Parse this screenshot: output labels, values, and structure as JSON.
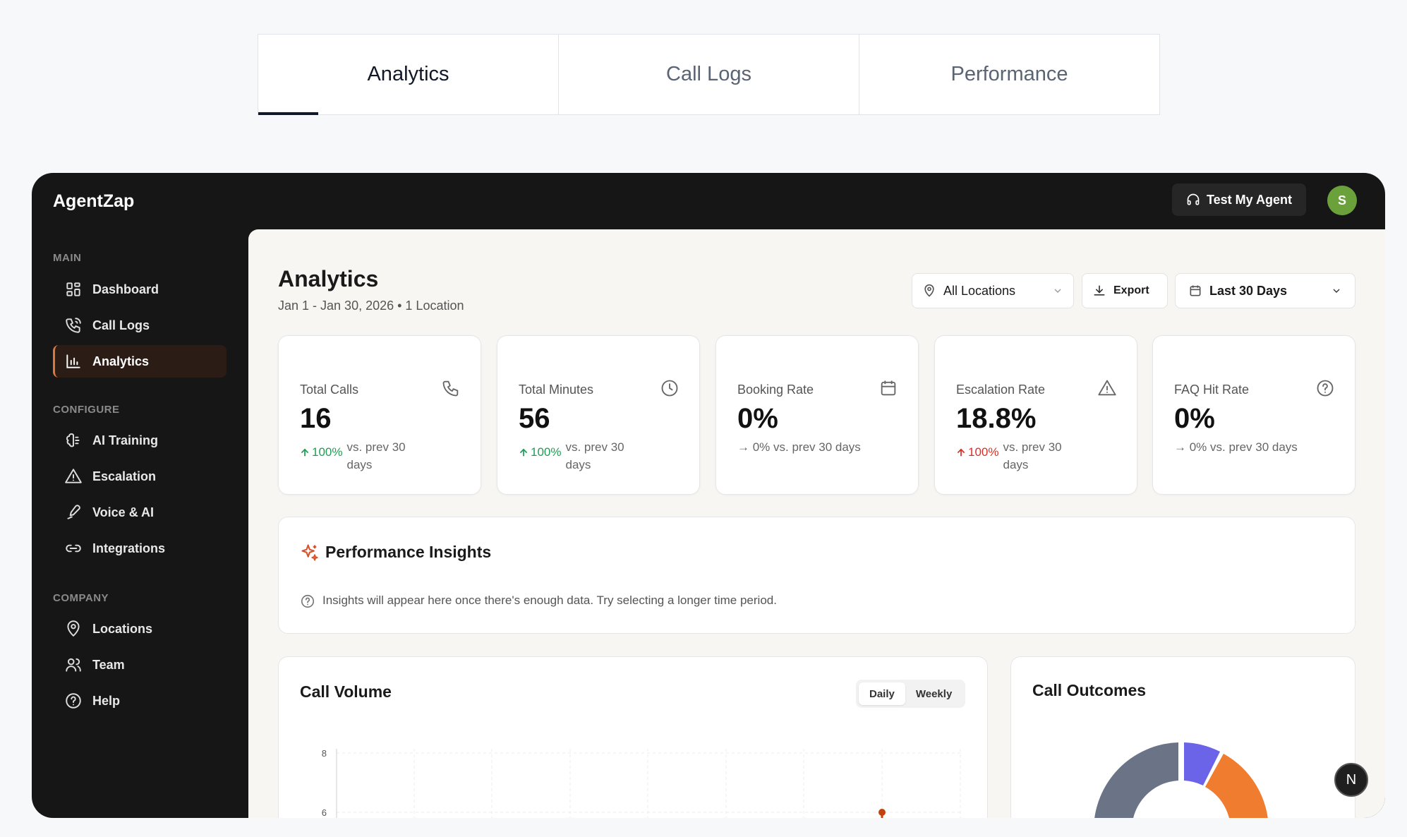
{
  "top_tabs": [
    {
      "label": "Analytics"
    },
    {
      "label": "Call Logs"
    },
    {
      "label": "Performance"
    }
  ],
  "app": {
    "logo": "AgentZap",
    "test_button": "Test My Agent",
    "avatar_initial": "S"
  },
  "sidebar": {
    "sections": [
      {
        "title": "MAIN"
      },
      {
        "title": "CONFIGURE"
      },
      {
        "title": "COMPANY"
      }
    ],
    "items": [
      {
        "label": "Dashboard",
        "icon": "grid-icon"
      },
      {
        "label": "Call Logs",
        "icon": "phone-icon"
      },
      {
        "label": "Analytics",
        "icon": "bar-chart-icon",
        "active": true
      },
      {
        "label": "AI Training",
        "icon": "brain-icon"
      },
      {
        "label": "Escalation",
        "icon": "warning-icon"
      },
      {
        "label": "Voice & AI",
        "icon": "pen-icon"
      },
      {
        "label": "Integrations",
        "icon": "link-icon"
      },
      {
        "label": "Locations",
        "icon": "pin-icon"
      },
      {
        "label": "Team",
        "icon": "users-icon"
      },
      {
        "label": "Help",
        "icon": "help-icon"
      }
    ]
  },
  "header": {
    "title": "Analytics",
    "subtitle": "Jan 1 - Jan 30, 2026 • 1 Location",
    "locations_select": "All Locations",
    "export_label": "Export",
    "range_select": "Last 30 Days"
  },
  "kpis": [
    {
      "label": "Total Calls",
      "value": "16",
      "change_pct": "100%",
      "change_text": "vs. prev 30 days",
      "direction": "up",
      "color": "#1f9d55"
    },
    {
      "label": "Total Minutes",
      "value": "56",
      "change_pct": "100%",
      "change_text": "vs. prev 30 days",
      "direction": "up",
      "color": "#1f9d55"
    },
    {
      "label": "Booking Rate",
      "value": "0%",
      "change_text": "→ 0% vs. prev 30 days",
      "direction": "flat"
    },
    {
      "label": "Escalation Rate",
      "value": "18.8%",
      "change_pct": "100%",
      "change_text": "vs. prev 30 days",
      "direction": "up",
      "color": "#d93025"
    },
    {
      "label": "FAQ Hit Rate",
      "value": "0%",
      "change_text": "→ 0% vs. prev 30 days",
      "direction": "flat"
    }
  ],
  "insights": {
    "title": "Performance Insights",
    "message": "Insights will appear here once there's enough data. Try selecting a longer time period."
  },
  "call_volume": {
    "title": "Call Volume",
    "toggle": [
      "Daily",
      "Weekly"
    ],
    "active_toggle": "Daily",
    "y_ticks": [
      "8",
      "6"
    ],
    "line_color": "#c2410c"
  },
  "call_outcomes": {
    "title": "Call Outcomes",
    "colors": [
      "#6b7386",
      "#6b63e8",
      "#f07c2f"
    ]
  },
  "fab_label": "N"
}
